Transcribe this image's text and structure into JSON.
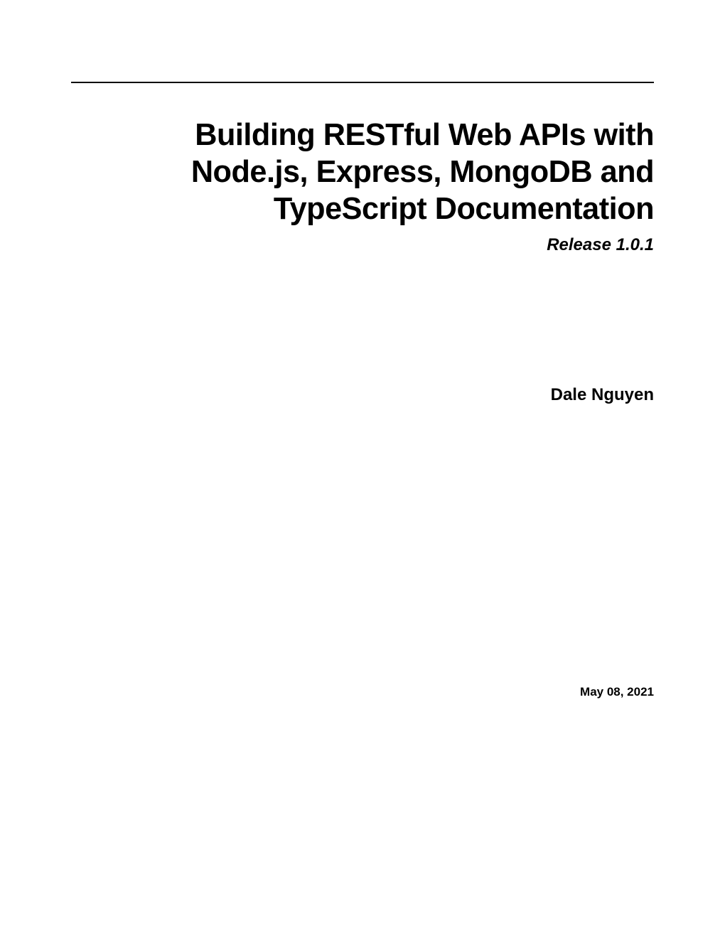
{
  "title": "Building RESTful Web APIs with Node.js, Express, MongoDB and TypeScript Documentation",
  "release": "Release 1.0.1",
  "author": "Dale Nguyen",
  "date": "May 08, 2021"
}
